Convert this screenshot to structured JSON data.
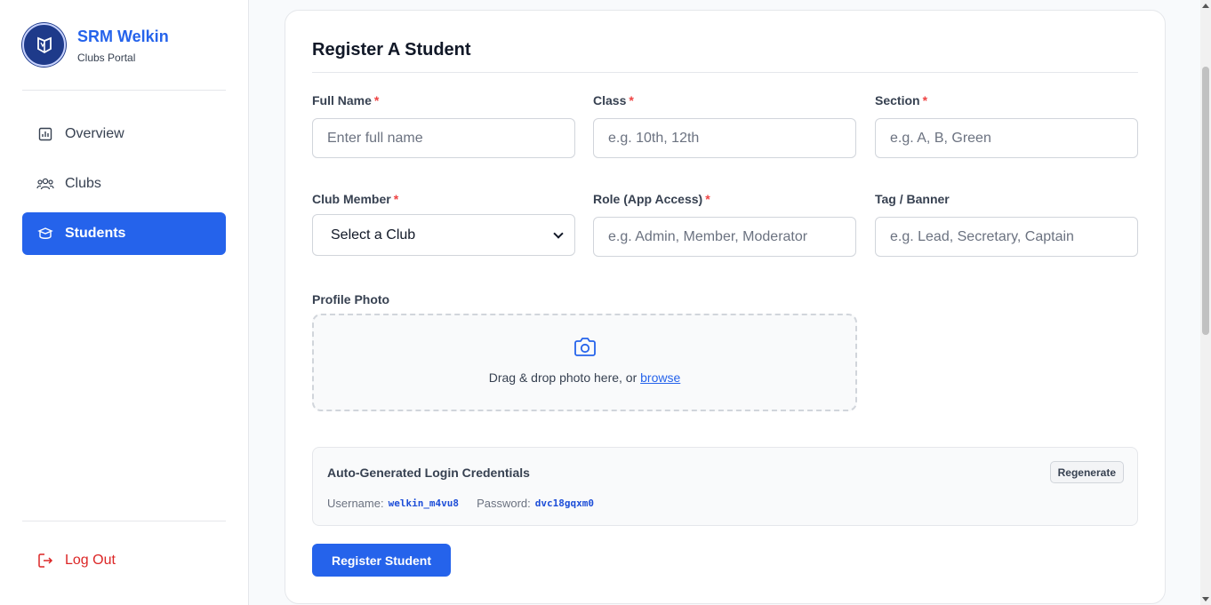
{
  "brand": {
    "title": "SRM Welkin",
    "subtitle": "Clubs Portal"
  },
  "nav": [
    {
      "label": "Overview",
      "icon": "chart-icon",
      "active": false
    },
    {
      "label": "Clubs",
      "icon": "users-icon",
      "active": false
    },
    {
      "label": "Students",
      "icon": "student-icon",
      "active": true
    }
  ],
  "logout": {
    "label": "Log Out",
    "color": "#dc2626"
  },
  "form": {
    "title": "Register A Student",
    "required_mark": "*",
    "full_name": {
      "label": "Full Name",
      "placeholder": "Enter full name",
      "value": ""
    },
    "class": {
      "label": "Class",
      "placeholder": "e.g. 10th, 12th",
      "value": ""
    },
    "section": {
      "label": "Section",
      "placeholder": "e.g. A, B, Green",
      "value": ""
    },
    "club": {
      "label": "Club Member",
      "selected": "Select a Club"
    },
    "role": {
      "label": "Role (App Access)",
      "placeholder": "e.g. Admin, Member, Moderator",
      "value": ""
    },
    "tag": {
      "label": "Tag / Banner",
      "placeholder": "e.g. Lead, Secretary, Captain",
      "value": ""
    },
    "photo": {
      "label": "Profile Photo",
      "hint": "Drag & drop photo here, or",
      "browse": "browse"
    },
    "credentials": {
      "title": "Auto-Generated Login Credentials",
      "regenerate": "Regenerate",
      "username_label": "Username:",
      "username": "welkin_m4vu8",
      "password_label": "Password:",
      "password": "dvc18gqxm0"
    },
    "submit": "Register Student"
  },
  "colors": {
    "primary": "#2563eb",
    "danger": "#dc2626",
    "required": "#ef4444"
  }
}
